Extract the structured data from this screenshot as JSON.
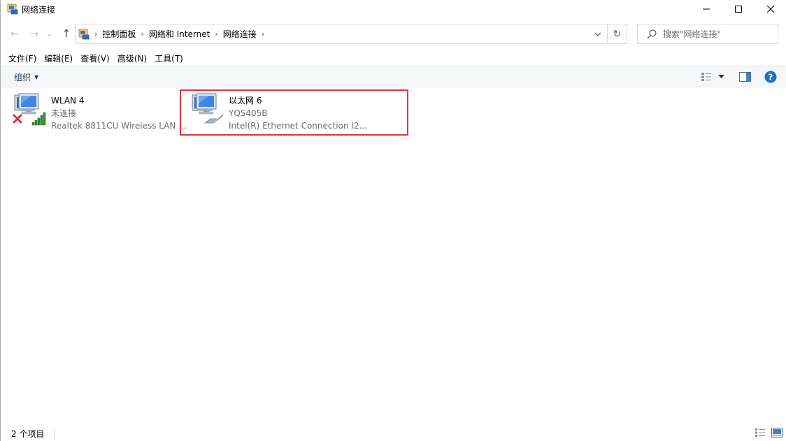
{
  "window": {
    "title": "网络连接",
    "controls": {
      "minimize": "—",
      "maximize": "☐",
      "close": "✕"
    }
  },
  "nav": {
    "back": "←",
    "forward": "→",
    "recent": "⌄",
    "up": "↑"
  },
  "address": {
    "crumbs": [
      "控制面板",
      "网络和 Internet",
      "网络连接"
    ],
    "refresh": "↻"
  },
  "search": {
    "placeholder": "搜索\"网络连接\""
  },
  "menu": [
    "文件(F)",
    "编辑(E)",
    "查看(V)",
    "高级(N)",
    "工具(T)"
  ],
  "commandbar": {
    "organize": "组织"
  },
  "connections": [
    {
      "name": "WLAN 4",
      "status": "未连接",
      "device": "Realtek 8811CU Wireless LAN ...",
      "type": "wireless",
      "state": "disconnected"
    },
    {
      "name": "以太网 6",
      "status": "YQS405B",
      "device": "Intel(R) Ethernet Connection I2...",
      "type": "ethernet",
      "state": "connected",
      "highlighted": true
    }
  ],
  "status": {
    "count": "2 个项目"
  },
  "colors": {
    "highlight": "#d9363e",
    "error": "#d9363e",
    "signal": "#2f8f2f",
    "help": "#1a6fd6"
  }
}
